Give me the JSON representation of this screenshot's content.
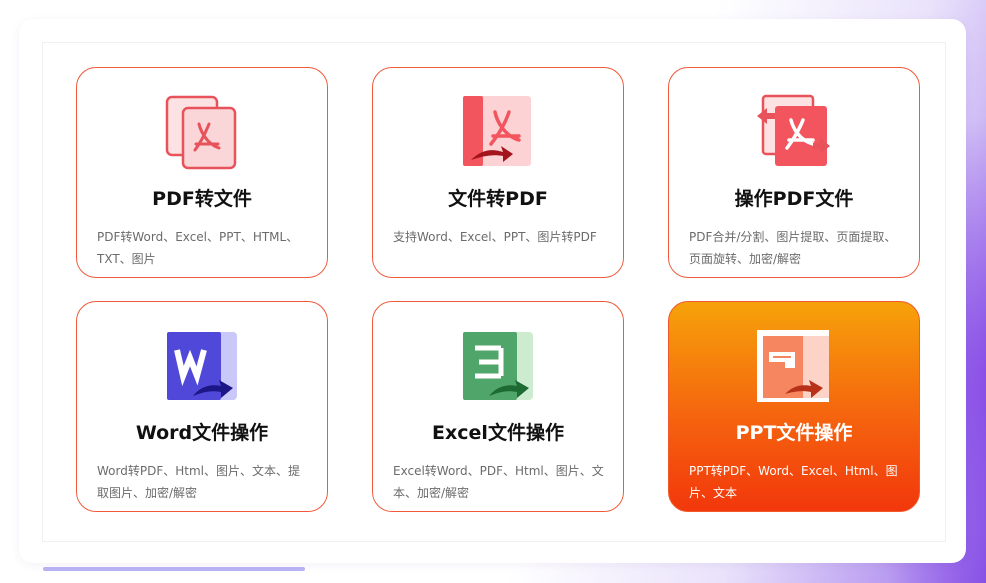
{
  "cards": [
    {
      "title": "PDF转文件",
      "desc": "PDF转Word、Excel、PPT、HTML、TXT、图片",
      "icon": "pdf-to-file-icon"
    },
    {
      "title": "文件转PDF",
      "desc": "支持Word、Excel、PPT、图片转PDF",
      "icon": "file-to-pdf-icon"
    },
    {
      "title": "操作PDF文件",
      "desc": "PDF合并/分割、图片提取、页面提取、页面旋转、加密/解密",
      "icon": "operate-pdf-icon"
    },
    {
      "title": "Word文件操作",
      "desc": "Word转PDF、Html、图片、文本、提取图片、加密/解密",
      "icon": "word-file-icon"
    },
    {
      "title": "Excel文件操作",
      "desc": "Excel转Word、PDF、Html、图片、文本、加密/解密",
      "icon": "excel-file-icon"
    },
    {
      "title": "PPT文件操作",
      "desc": "PPT转PDF、Word、Excel、Html、图片、文本",
      "icon": "ppt-file-icon"
    }
  ],
  "colors": {
    "accent": "#f2593b",
    "active_top": "#f6a20a",
    "active_bottom": "#f2370c",
    "pdf_red": "#f2555e",
    "word_blue": "#5048d8",
    "excel_green": "#4fa56a"
  }
}
